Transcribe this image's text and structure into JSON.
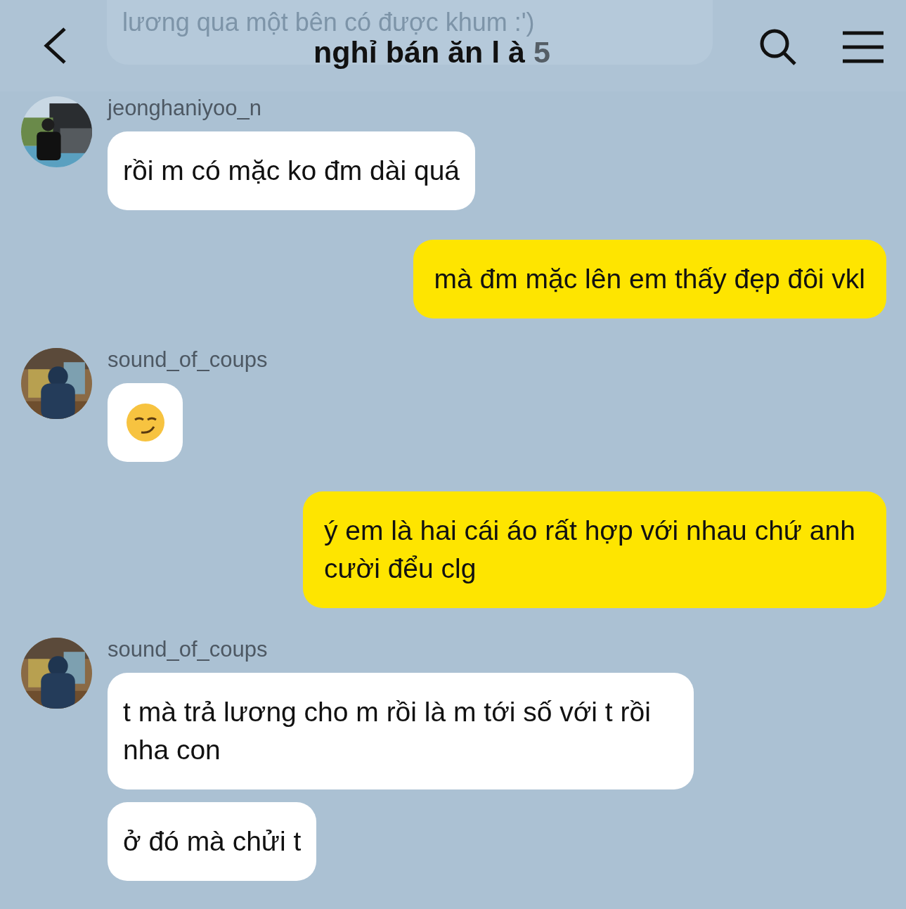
{
  "header": {
    "faded_message": "lương qua một bên có được khum :')",
    "title": "nghỉ bán ăn l à",
    "member_count": "5"
  },
  "messages": [
    {
      "kind": "received",
      "sender": "jeonghaniyoo_n",
      "bubbles": [
        {
          "kind": "text",
          "text": "rồi m có mặc ko đm dài quá"
        }
      ]
    },
    {
      "kind": "sent",
      "bubbles": [
        {
          "kind": "text",
          "text": "mà đm mặc lên em thấy đẹp đôi vkl"
        }
      ]
    },
    {
      "kind": "received",
      "sender": "sound_of_coups",
      "bubbles": [
        {
          "kind": "emoji"
        }
      ]
    },
    {
      "kind": "sent",
      "bubbles": [
        {
          "kind": "text",
          "text": "ý em là hai cái áo rất hợp với nhau chứ anh cười đểu clg"
        }
      ]
    },
    {
      "kind": "received",
      "sender": "sound_of_coups",
      "bubbles": [
        {
          "kind": "text",
          "text": "t mà trả lương cho m rồi là m tới số với t rồi nha con"
        },
        {
          "kind": "text",
          "text": "ở đó mà chửi t"
        }
      ]
    }
  ]
}
